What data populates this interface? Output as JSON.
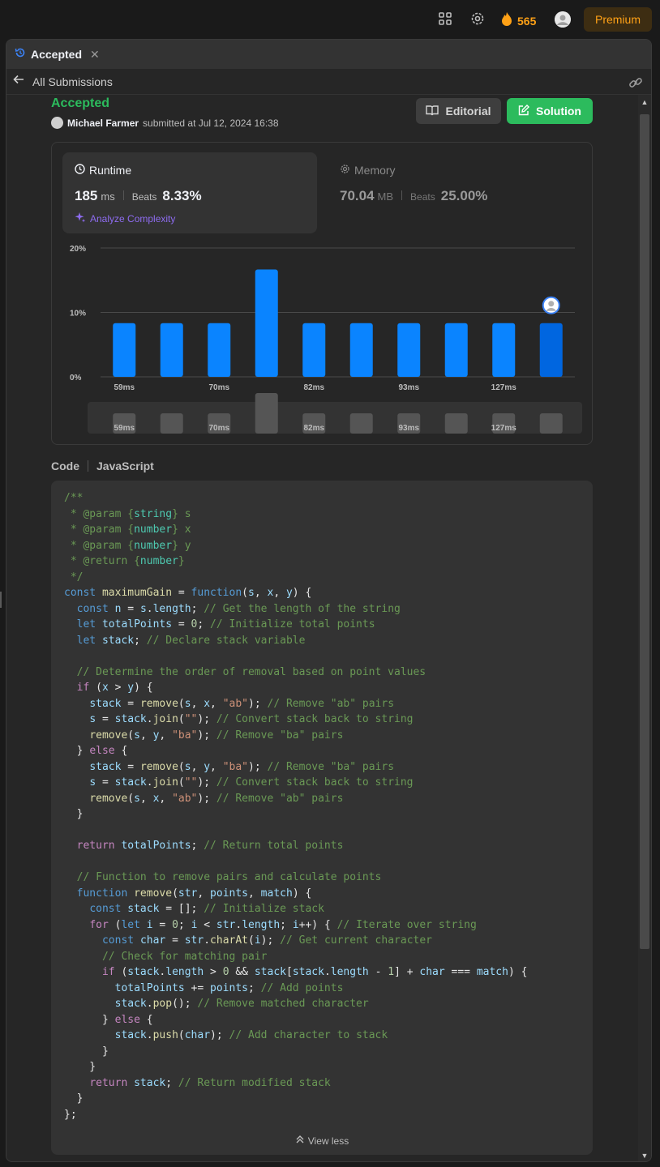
{
  "topbar": {
    "streak_count": "565",
    "premium_label": "Premium",
    "icons": [
      "layout-icon",
      "gear-icon",
      "fire-icon",
      "avatar"
    ]
  },
  "tab": {
    "title": "Accepted"
  },
  "subbar": {
    "back_label": "All Submissions"
  },
  "submission": {
    "status": "Accepted",
    "author": "Michael Farmer",
    "submitted_text": "submitted at Jul 12, 2024 16:38",
    "editorial_label": "Editorial",
    "solution_label": "Solution"
  },
  "runtime": {
    "title": "Runtime",
    "value": "185",
    "unit": "ms",
    "beats_label": "Beats",
    "beats_value": "8.33%",
    "analyze_label": "Analyze Complexity"
  },
  "memory": {
    "title": "Memory",
    "value": "70.04",
    "unit": "MB",
    "beats_label": "Beats",
    "beats_value": "25.00%"
  },
  "chart_data": {
    "type": "bar",
    "categories": [
      "59ms",
      "",
      "70ms",
      "",
      "82ms",
      "",
      "93ms",
      "",
      "127ms",
      ""
    ],
    "values": [
      8.33,
      8.33,
      8.33,
      16.67,
      8.33,
      8.33,
      8.33,
      8.33,
      8.33,
      8.33
    ],
    "y_ticks": [
      "20%",
      "10%",
      "0%"
    ],
    "ylim": [
      0,
      20
    ],
    "highlight_index": 9,
    "bar_color": "#0a84ff",
    "xlabel": "",
    "ylabel": ""
  },
  "code": {
    "label": "Code",
    "language": "JavaScript",
    "view_less_label": "View less",
    "lines": [
      "/**",
      " * @param {string} s",
      " * @param {number} x",
      " * @param {number} y",
      " * @return {number}",
      " */",
      "const maximumGain = function(s, x, y) {",
      "  const n = s.length; // Get the length of the string",
      "  let totalPoints = 0; // Initialize total points",
      "  let stack; // Declare stack variable",
      "",
      "  // Determine the order of removal based on point values",
      "  if (x > y) {",
      "    stack = remove(s, x, \"ab\"); // Remove \"ab\" pairs",
      "    s = stack.join(\"\"); // Convert stack back to string",
      "    remove(s, y, \"ba\"); // Remove \"ba\" pairs",
      "  } else {",
      "    stack = remove(s, y, \"ba\"); // Remove \"ba\" pairs",
      "    s = stack.join(\"\"); // Convert stack back to string",
      "    remove(s, x, \"ab\"); // Remove \"ab\" pairs",
      "  }",
      "",
      "  return totalPoints; // Return total points",
      "",
      "  // Function to remove pairs and calculate points",
      "  function remove(str, points, match) {",
      "    const stack = []; // Initialize stack",
      "    for (let i = 0; i < str.length; i++) { // Iterate over string",
      "      const char = str.charAt(i); // Get current character",
      "      // Check for matching pair",
      "      if (stack.length > 0 && stack[stack.length - 1] + char === match) {",
      "        totalPoints += points; // Add points",
      "        stack.pop(); // Remove matched character",
      "      } else {",
      "        stack.push(char); // Add character to stack",
      "      }",
      "    }",
      "    return stack; // Return modified stack",
      "  }",
      "};"
    ]
  }
}
